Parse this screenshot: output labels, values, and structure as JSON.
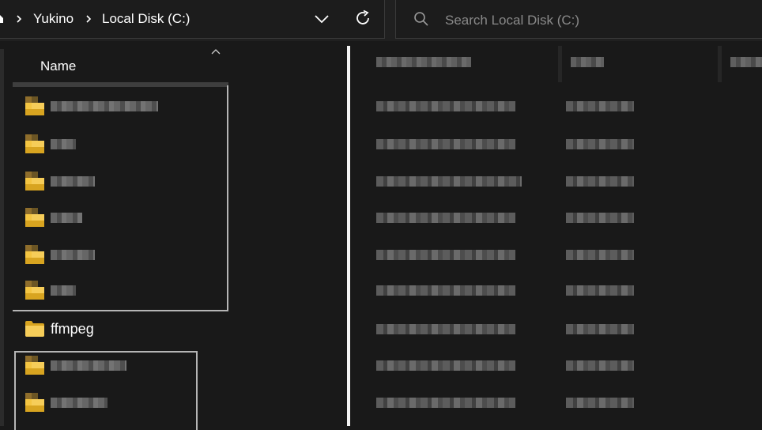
{
  "breadcrumb": {
    "items": [
      "Yukino",
      "Local Disk (C:)"
    ]
  },
  "search": {
    "placeholder": "Search Local Disk (C:)"
  },
  "columns": {
    "name": "Name"
  },
  "files": [
    {
      "name": "",
      "redacted": true
    },
    {
      "name": "",
      "redacted": true
    },
    {
      "name": "",
      "redacted": true
    },
    {
      "name": "",
      "redacted": true
    },
    {
      "name": "",
      "redacted": true
    },
    {
      "name": "",
      "redacted": true
    },
    {
      "name": "ffmpeg",
      "redacted": false
    },
    {
      "name": "",
      "redacted": true
    },
    {
      "name": "",
      "redacted": true
    }
  ],
  "icons": {
    "home": "home-icon",
    "separator": "chevron-right-icon",
    "dropdown": "chevron-down-icon",
    "refresh": "refresh-icon",
    "search": "search-icon",
    "sort": "chevron-up-icon",
    "folder": "folder-icon"
  },
  "colors": {
    "background": "#191919",
    "toolbar": "#202020",
    "folder": "#f4c542",
    "folder_dark": "#d8a420",
    "text": "#ffffff",
    "placeholder": "#8a8a8a"
  }
}
